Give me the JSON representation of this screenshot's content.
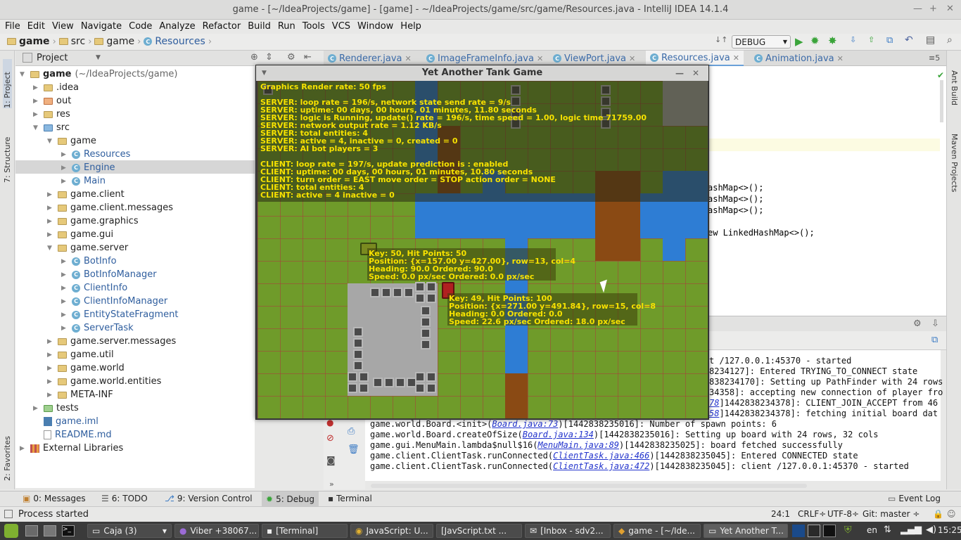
{
  "window": {
    "title": "game - [~/IdeaProjects/game] - [game] - ~/IdeaProjects/game/src/game/Resources.java - IntelliJ IDEA 14.1.4"
  },
  "menu": [
    "File",
    "Edit",
    "View",
    "Navigate",
    "Code",
    "Analyze",
    "Refactor",
    "Build",
    "Run",
    "Tools",
    "VCS",
    "Window",
    "Help"
  ],
  "breadcrumb": [
    "game",
    "src",
    "game",
    "Resources"
  ],
  "run_config": "DEBUG",
  "left_strip": {
    "project": "1: Project",
    "structure": "7: Structure",
    "favorites": "2: Favorites"
  },
  "right_strip": {
    "ant": "Ant Build",
    "maven": "Maven Projects"
  },
  "project_panel": {
    "title": "Project"
  },
  "tree": {
    "root": "game",
    "root_path": "(~/IdeaProjects/game)",
    "items": [
      {
        "label": ".idea"
      },
      {
        "label": "out"
      },
      {
        "label": "res"
      },
      {
        "label": "src"
      },
      {
        "label": "game"
      },
      {
        "label": "Resources"
      },
      {
        "label": "Engine"
      },
      {
        "label": "Main"
      },
      {
        "label": "game.client"
      },
      {
        "label": "game.client.messages"
      },
      {
        "label": "game.graphics"
      },
      {
        "label": "game.gui"
      },
      {
        "label": "game.server"
      },
      {
        "label": "BotInfo"
      },
      {
        "label": "BotInfoManager"
      },
      {
        "label": "ClientInfo"
      },
      {
        "label": "ClientInfoManager"
      },
      {
        "label": "EntityStateFragment"
      },
      {
        "label": "ServerTask"
      },
      {
        "label": "game.server.messages"
      },
      {
        "label": "game.util"
      },
      {
        "label": "game.world"
      },
      {
        "label": "game.world.entities"
      },
      {
        "label": "META-INF"
      },
      {
        "label": "tests"
      },
      {
        "label": "game.iml"
      },
      {
        "label": "README.md"
      },
      {
        "label": "External Libraries"
      }
    ]
  },
  "tabs": [
    "Renderer.java",
    "ImageFrameInfo.java",
    "ViewPort.java",
    "Resources.java",
    "Animation.java"
  ],
  "code": [
    "ashMap<>();",
    "ashMap<>();",
    "ashMap<>();",
    "ew LinkedHashMap<>();"
  ],
  "console": {
    "top_lines": [
      "t /127.0.0.1:45370 - started",
      "8234127]: Entered TRYING_TO_CONNECT state",
      "838234170]: Setting up PathFinder with 24 rows",
      "34358]: accepting new connection of player fro",
      "78",
      "]1442838234378]: CLIENT_JOIN_ACCEPT from 46",
      "58",
      "]1442838234378]: fetching initial board dat"
    ],
    "lines": [
      {
        "pre": "game.world.Board.<init>(",
        "link": "Board.java:73",
        "post": ")[1442838235016]: Number of spawn points: 6"
      },
      {
        "pre": "game.world.Board.createOfSize(",
        "link": "Board.java:134",
        "post": ")[1442838235016]: Setting up board with 24 rows, 32 cols"
      },
      {
        "pre": "game.gui.MenuMain.lambda$null$16(",
        "link": "MenuMain.java:89",
        "post": ")[1442838235025]: board fetched successfully"
      },
      {
        "pre": "game.client.ClientTask.runConnected(",
        "link": "ClientTask.java:466",
        "post": ")[1442838235045]: Entered CONNECTED state"
      },
      {
        "pre": "game.client.ClientTask.runConnected(",
        "link": "ClientTask.java:472",
        "post": ")[1442838235045]: client /127.0.0.1:45370 - started"
      }
    ]
  },
  "tool_windows": {
    "messages": "0: Messages",
    "todo": "6: TODO",
    "vcs": "9: Version Control",
    "debug": "5: Debug",
    "terminal": "Terminal",
    "eventlog": "Event Log"
  },
  "status": {
    "text": "Process started",
    "pos": "24:1",
    "lf": "CRLF÷",
    "enc": "UTF-8÷",
    "git": "Git: master ÷"
  },
  "taskbar": {
    "items": [
      "Caja (3)",
      "Viber +38067...",
      "[Terminal]",
      "JavaScript: U...",
      "[JavScript.txt ...",
      "[Inbox - sdv2...",
      "game - [~/Ide...",
      "Yet Another T..."
    ],
    "lang": "en",
    "time": "15:25"
  },
  "game": {
    "title": "Yet Another Tank Game",
    "overlay": [
      "Graphics Render rate: 50 fps",
      "",
      "SERVER: loop rate = 196/s, network state send rate = 9/s",
      "SERVER: uptime: 00 days, 00 hours, 01 minutes, 11.80 seconds",
      "SERVER: logic is Running, update() rate = 196/s, time speed = 1.00, logic time 71759.00",
      "SERVER: network output rate = 1.12 KB/s",
      "SERVER: total entities: 4",
      "SERVER: active = 4, inactive = 0, created = 0",
      "SERVER: AI bot players = 3",
      "",
      "CLIENT: loop rate = 197/s, update prediction is : enabled",
      "CLIENT: uptime: 00 days, 00 hours, 01 minutes, 10.80 seconds",
      "CLIENT: turn order = EAST move order = STOP action order = NONE",
      "CLIENT: total entities: 4",
      "CLIENT: active = 4 inactive = 0"
    ],
    "tank1": [
      "Key: 50, Hit Points: 50",
      "Position: {x=157.00 y=427.00}, row=13, col=4",
      "Heading: 90.0 Ordered: 90.0",
      "Speed: 0.0 px/sec Ordered: 0.0 px/sec"
    ],
    "tank2": [
      "Key: 49, Hit Points: 100",
      "Position: {x=271.00 y=491.84}, row=15, col=8",
      "Heading: 0.0 Ordered: 0.0",
      "Speed: 22.6 px/sec Ordered: 18.0 px/sec"
    ]
  }
}
